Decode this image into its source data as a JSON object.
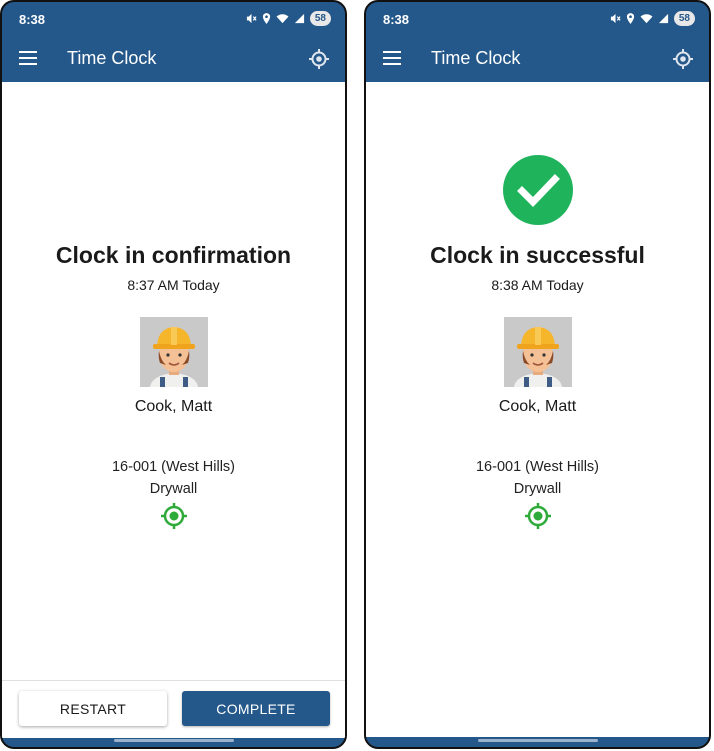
{
  "colors": {
    "brand": "#25588a",
    "success": "#1fb35b",
    "geo_green": "#2eaa3a"
  },
  "icons": {
    "menu": "hamburger-menu-icon",
    "location": "crosshair-location-icon",
    "success": "check-circle-icon",
    "geofence": "geofence-target-icon",
    "avatar": "construction-worker-avatar"
  },
  "status_bar": {
    "time": "8:38",
    "battery": "58"
  },
  "app": {
    "title": "Time Clock"
  },
  "screens": [
    {
      "heading": "Clock in confirmation",
      "timestamp": "8:37 AM Today",
      "employee_name": "Cook, Matt",
      "job": "16-001 (West Hills)",
      "task": "Drywall",
      "buttons": {
        "restart": "RESTART",
        "complete": "COMPLETE"
      }
    },
    {
      "heading": "Clock in successful",
      "timestamp": "8:38 AM Today",
      "employee_name": "Cook, Matt",
      "job": "16-001 (West Hills)",
      "task": "Drywall"
    }
  ]
}
